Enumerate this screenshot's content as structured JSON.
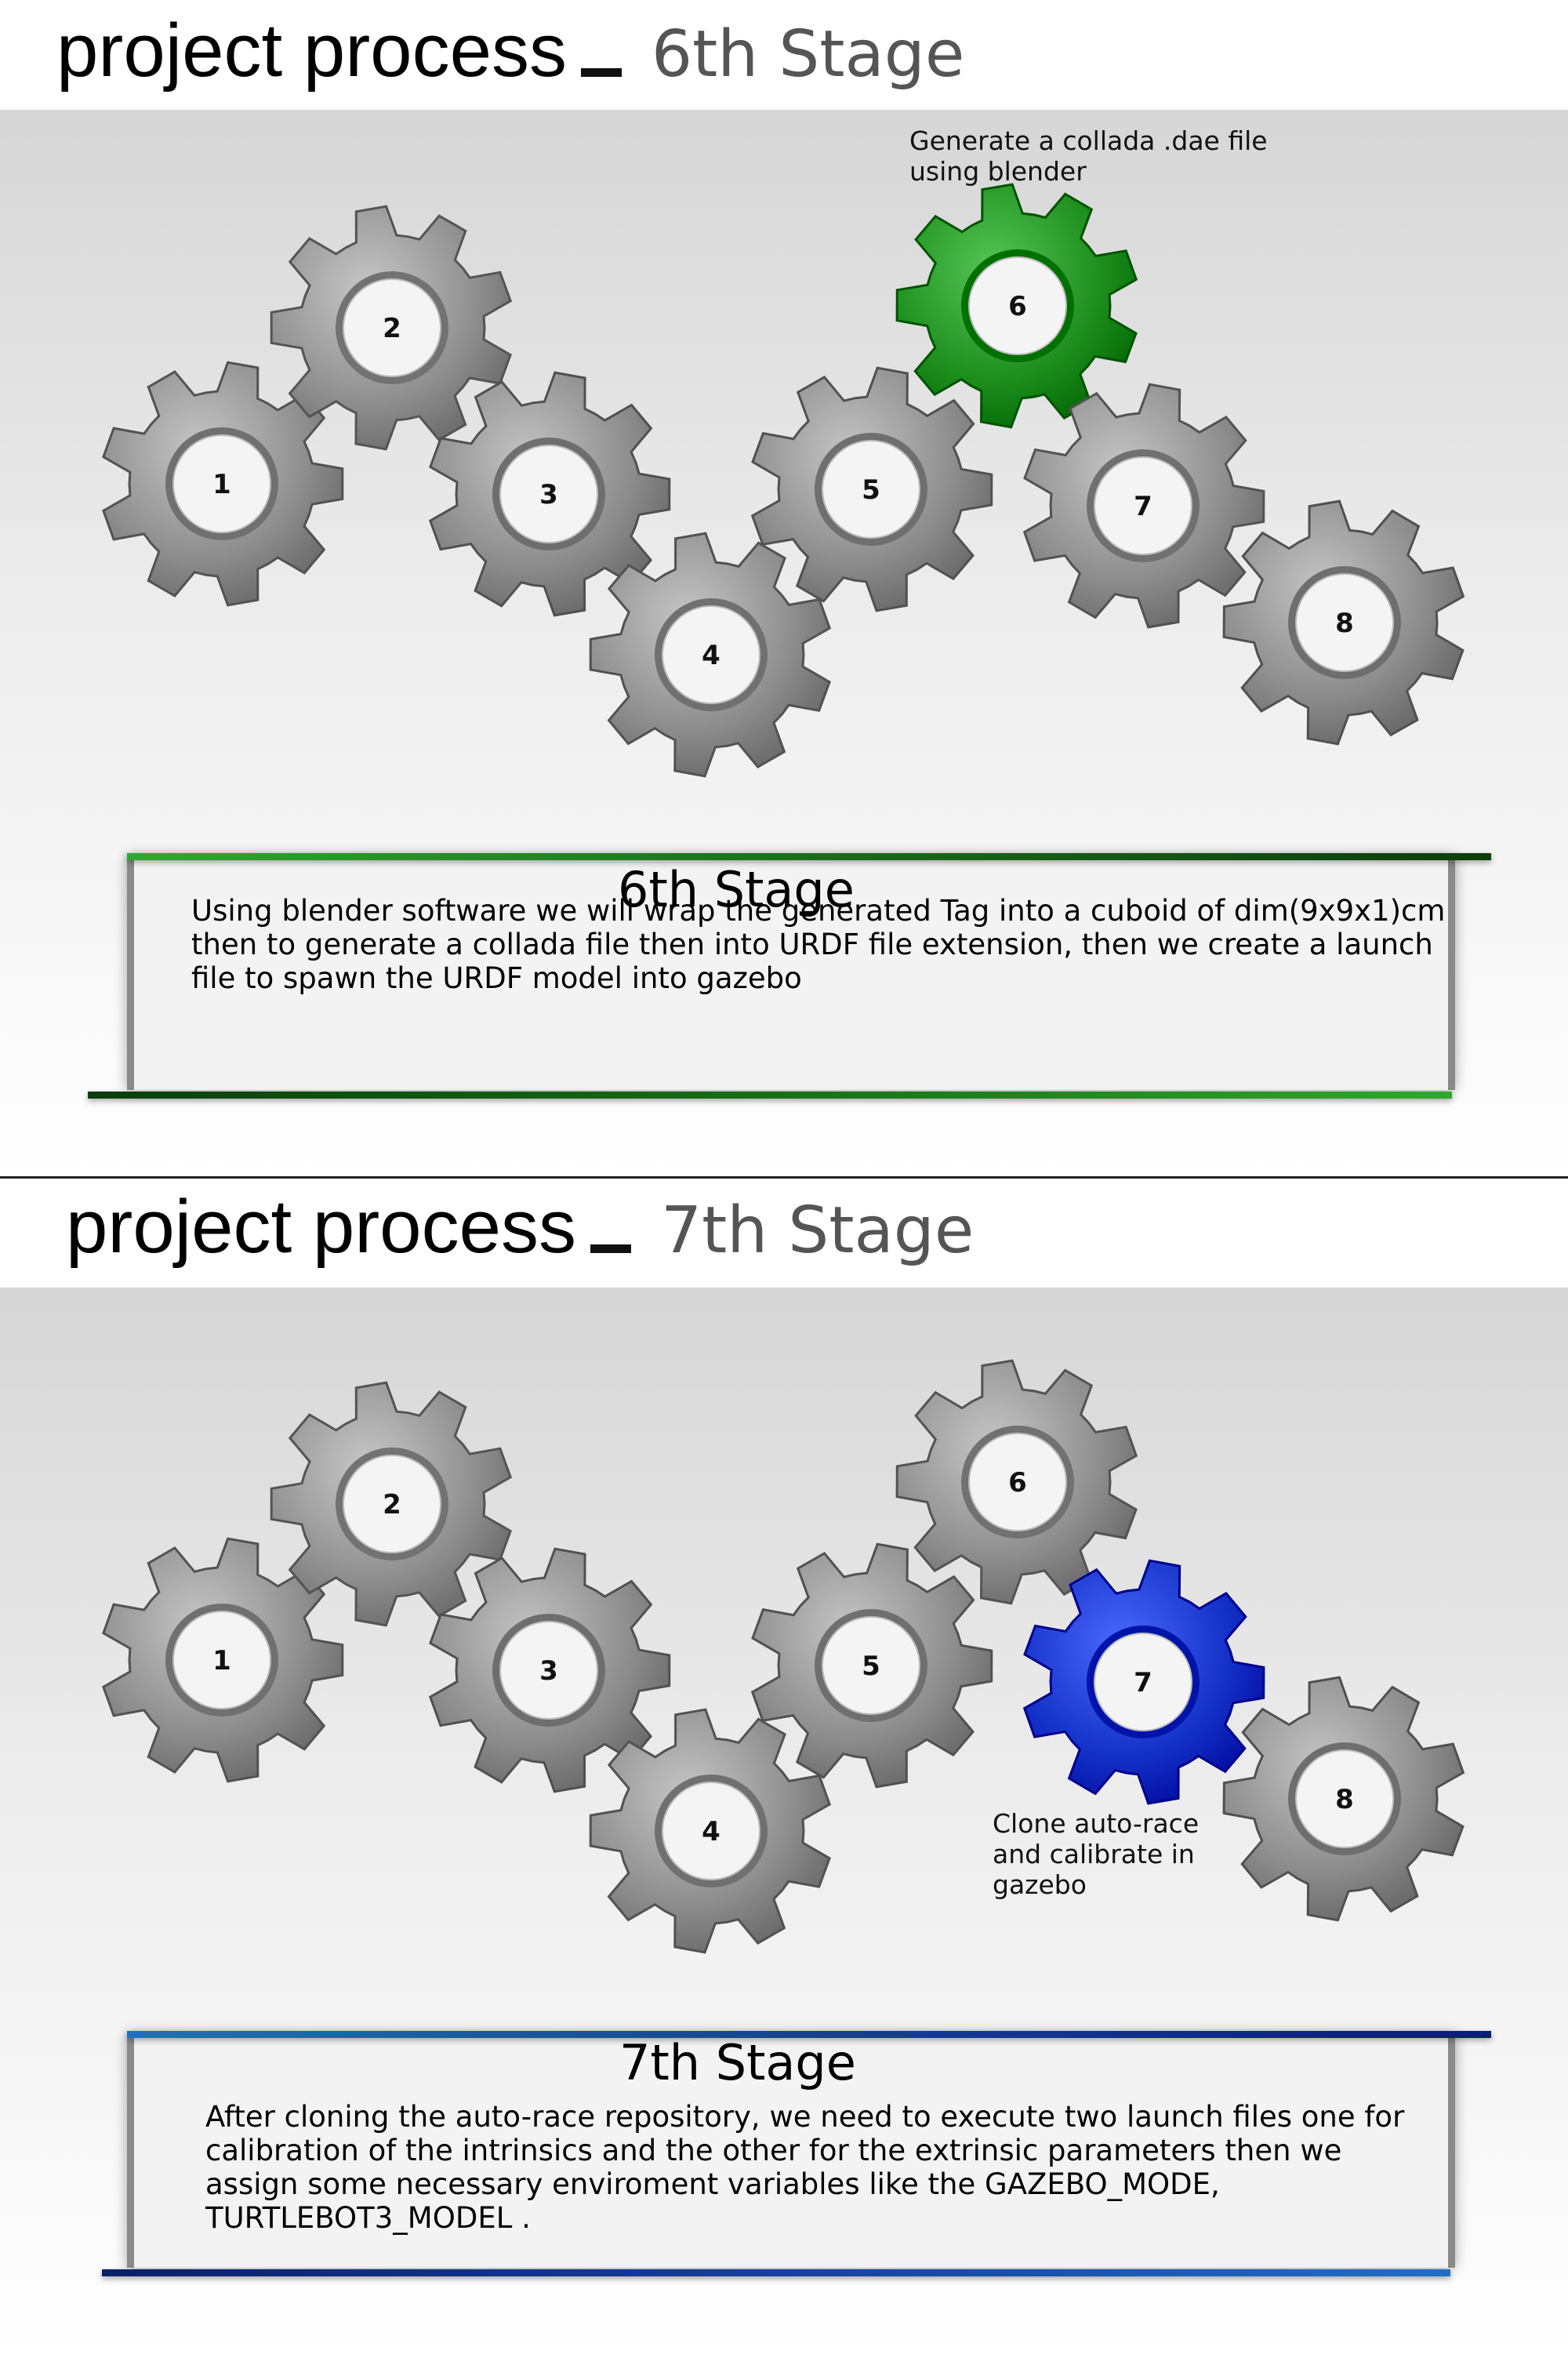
{
  "slides": [
    {
      "title_main": "project process",
      "title_stage": "6th Stage",
      "gear_labels": [
        "1",
        "2",
        "3",
        "4",
        "5",
        "6",
        "7",
        "8"
      ],
      "active_gear": "6",
      "active_color": "#1e8f1e",
      "callout": "Generate a collada .dae file\nusing blender",
      "box_title": "6th Stage",
      "box_text": "Using blender software we will wrap the generated Tag into a cuboid of dim(9x9x1)cm then to generate a collada file then into URDF file extension, then we create a launch file to spawn the URDF model into gazebo"
    },
    {
      "title_main": "project process",
      "title_stage": "7th Stage",
      "gear_labels": [
        "1",
        "2",
        "3",
        "4",
        "5",
        "6",
        "7",
        "8"
      ],
      "active_gear": "7",
      "active_color": "#1432c8",
      "callout": "Clone auto-race\nand calibrate in\ngazebo",
      "box_title": "7th Stage",
      "box_text": "After cloning the auto-race repository, we need to execute two launch files one for calibration of the intrinsics and the other for the extrinsic parameters then we assign some necessary enviroment variables like the GAZEBO_MODE, TURTLEBOT3_MODEL ."
    }
  ]
}
